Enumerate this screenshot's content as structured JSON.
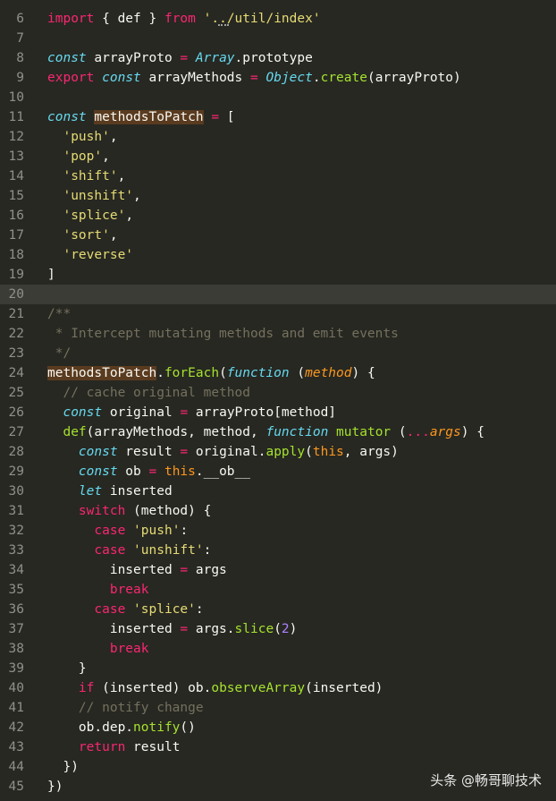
{
  "editor": {
    "theme_colors": {
      "background": "#272822",
      "keyword": "#f92672",
      "storage": "#66d9ef",
      "string": "#e6db74",
      "function": "#a6e22e",
      "parameter": "#fd971f",
      "number": "#ae81ff",
      "comment": "#75715e"
    },
    "current_line": 20,
    "lines": [
      {
        "n": "6",
        "tokens": [
          [
            "kw",
            "import"
          ],
          [
            "p",
            " { def } "
          ],
          [
            "kw",
            "from"
          ],
          [
            "p",
            " "
          ],
          [
            "str",
            "'../util/index'"
          ]
        ]
      },
      {
        "n": "7",
        "tokens": []
      },
      {
        "n": "8",
        "tokens": [
          [
            "st",
            "const"
          ],
          [
            "p",
            " arrayProto "
          ],
          [
            "kw",
            "="
          ],
          [
            "p",
            " "
          ],
          [
            "st",
            "Array"
          ],
          [
            "p",
            ".prototype"
          ]
        ]
      },
      {
        "n": "9",
        "tokens": [
          [
            "kw",
            "export"
          ],
          [
            "p",
            " "
          ],
          [
            "st",
            "const"
          ],
          [
            "p",
            " arrayMethods "
          ],
          [
            "kw",
            "="
          ],
          [
            "p",
            " "
          ],
          [
            "st",
            "Object"
          ],
          [
            "p",
            "."
          ],
          [
            "fn",
            "create"
          ],
          [
            "p",
            "(arrayProto)"
          ]
        ]
      },
      {
        "n": "10",
        "tokens": []
      },
      {
        "n": "11",
        "tokens": [
          [
            "st",
            "const"
          ],
          [
            "p",
            " "
          ],
          [
            "hl",
            "methodsToPatch"
          ],
          [
            "p",
            " "
          ],
          [
            "kw",
            "="
          ],
          [
            "p",
            " ["
          ]
        ]
      },
      {
        "n": "12",
        "tokens": [
          [
            "p",
            "  "
          ],
          [
            "str",
            "'push'"
          ],
          [
            "p",
            ","
          ]
        ]
      },
      {
        "n": "13",
        "tokens": [
          [
            "p",
            "  "
          ],
          [
            "str",
            "'pop'"
          ],
          [
            "p",
            ","
          ]
        ]
      },
      {
        "n": "14",
        "tokens": [
          [
            "p",
            "  "
          ],
          [
            "str",
            "'shift'"
          ],
          [
            "p",
            ","
          ]
        ]
      },
      {
        "n": "15",
        "tokens": [
          [
            "p",
            "  "
          ],
          [
            "str",
            "'unshift'"
          ],
          [
            "p",
            ","
          ]
        ]
      },
      {
        "n": "16",
        "tokens": [
          [
            "p",
            "  "
          ],
          [
            "str",
            "'splice'"
          ],
          [
            "p",
            ","
          ]
        ]
      },
      {
        "n": "17",
        "tokens": [
          [
            "p",
            "  "
          ],
          [
            "str",
            "'sort'"
          ],
          [
            "p",
            ","
          ]
        ]
      },
      {
        "n": "18",
        "tokens": [
          [
            "p",
            "  "
          ],
          [
            "str",
            "'reverse'"
          ]
        ]
      },
      {
        "n": "19",
        "tokens": [
          [
            "p",
            "]"
          ]
        ]
      },
      {
        "n": "20",
        "tokens": []
      },
      {
        "n": "21",
        "tokens": [
          [
            "cm",
            "/**"
          ]
        ]
      },
      {
        "n": "22",
        "tokens": [
          [
            "cm",
            " * Intercept mutating methods and emit events"
          ]
        ]
      },
      {
        "n": "23",
        "tokens": [
          [
            "cm",
            " */"
          ]
        ]
      },
      {
        "n": "24",
        "tokens": [
          [
            "hl",
            "methodsToPatch"
          ],
          [
            "p",
            "."
          ],
          [
            "fn",
            "forEach"
          ],
          [
            "p",
            "("
          ],
          [
            "st",
            "function"
          ],
          [
            "p",
            " ("
          ],
          [
            "param",
            "method"
          ],
          [
            "p",
            ") {"
          ]
        ]
      },
      {
        "n": "25",
        "tokens": [
          [
            "p",
            "  "
          ],
          [
            "cm",
            "// cache original method"
          ]
        ]
      },
      {
        "n": "26",
        "tokens": [
          [
            "p",
            "  "
          ],
          [
            "st",
            "const"
          ],
          [
            "p",
            " original "
          ],
          [
            "kw",
            "="
          ],
          [
            "p",
            " arrayProto[method]"
          ]
        ]
      },
      {
        "n": "27",
        "tokens": [
          [
            "p",
            "  "
          ],
          [
            "fn",
            "def"
          ],
          [
            "p",
            "(arrayMethods, method, "
          ],
          [
            "st",
            "function"
          ],
          [
            "p",
            " "
          ],
          [
            "fn",
            "mutator"
          ],
          [
            "p",
            " ("
          ],
          [
            "kw",
            "..."
          ],
          [
            "param",
            "args"
          ],
          [
            "p",
            ") {"
          ]
        ]
      },
      {
        "n": "28",
        "tokens": [
          [
            "p",
            "    "
          ],
          [
            "st",
            "const"
          ],
          [
            "p",
            " result "
          ],
          [
            "kw",
            "="
          ],
          [
            "p",
            " original."
          ],
          [
            "fn",
            "apply"
          ],
          [
            "p",
            "("
          ],
          [
            "this",
            "this"
          ],
          [
            "p",
            ", args)"
          ]
        ]
      },
      {
        "n": "29",
        "tokens": [
          [
            "p",
            "    "
          ],
          [
            "st",
            "const"
          ],
          [
            "p",
            " ob "
          ],
          [
            "kw",
            "="
          ],
          [
            "p",
            " "
          ],
          [
            "this",
            "this"
          ],
          [
            "p",
            ".__ob__"
          ]
        ]
      },
      {
        "n": "30",
        "tokens": [
          [
            "p",
            "    "
          ],
          [
            "st",
            "let"
          ],
          [
            "p",
            " inserted"
          ]
        ]
      },
      {
        "n": "31",
        "tokens": [
          [
            "p",
            "    "
          ],
          [
            "kw",
            "switch"
          ],
          [
            "p",
            " (method) {"
          ]
        ]
      },
      {
        "n": "32",
        "tokens": [
          [
            "p",
            "      "
          ],
          [
            "kw",
            "case"
          ],
          [
            "p",
            " "
          ],
          [
            "str",
            "'push'"
          ],
          [
            "p",
            ":"
          ]
        ]
      },
      {
        "n": "33",
        "tokens": [
          [
            "p",
            "      "
          ],
          [
            "kw",
            "case"
          ],
          [
            "p",
            " "
          ],
          [
            "str",
            "'unshift'"
          ],
          [
            "p",
            ":"
          ]
        ]
      },
      {
        "n": "34",
        "tokens": [
          [
            "p",
            "        inserted "
          ],
          [
            "kw",
            "="
          ],
          [
            "p",
            " args"
          ]
        ]
      },
      {
        "n": "35",
        "tokens": [
          [
            "p",
            "        "
          ],
          [
            "kw",
            "break"
          ]
        ]
      },
      {
        "n": "36",
        "tokens": [
          [
            "p",
            "      "
          ],
          [
            "kw",
            "case"
          ],
          [
            "p",
            " "
          ],
          [
            "str",
            "'splice'"
          ],
          [
            "p",
            ":"
          ]
        ]
      },
      {
        "n": "37",
        "tokens": [
          [
            "p",
            "        inserted "
          ],
          [
            "kw",
            "="
          ],
          [
            "p",
            " args."
          ],
          [
            "fn",
            "slice"
          ],
          [
            "p",
            "("
          ],
          [
            "num",
            "2"
          ],
          [
            "p",
            ")"
          ]
        ]
      },
      {
        "n": "38",
        "tokens": [
          [
            "p",
            "        "
          ],
          [
            "kw",
            "break"
          ]
        ]
      },
      {
        "n": "39",
        "tokens": [
          [
            "p",
            "    }"
          ]
        ]
      },
      {
        "n": "40",
        "tokens": [
          [
            "p",
            "    "
          ],
          [
            "kw",
            "if"
          ],
          [
            "p",
            " (inserted) ob."
          ],
          [
            "fn",
            "observeArray"
          ],
          [
            "p",
            "(inserted)"
          ]
        ]
      },
      {
        "n": "41",
        "tokens": [
          [
            "p",
            "    "
          ],
          [
            "cm",
            "// notify change"
          ]
        ]
      },
      {
        "n": "42",
        "tokens": [
          [
            "p",
            "    ob.dep."
          ],
          [
            "fn",
            "notify"
          ],
          [
            "p",
            "()"
          ]
        ]
      },
      {
        "n": "43",
        "tokens": [
          [
            "p",
            "    "
          ],
          [
            "kw",
            "return"
          ],
          [
            "p",
            " result"
          ]
        ]
      },
      {
        "n": "44",
        "tokens": [
          [
            "p",
            "  })"
          ]
        ]
      },
      {
        "n": "45",
        "tokens": [
          [
            "p",
            "})"
          ]
        ]
      }
    ]
  },
  "watermark": {
    "text": "头条 @畅哥聊技术"
  }
}
